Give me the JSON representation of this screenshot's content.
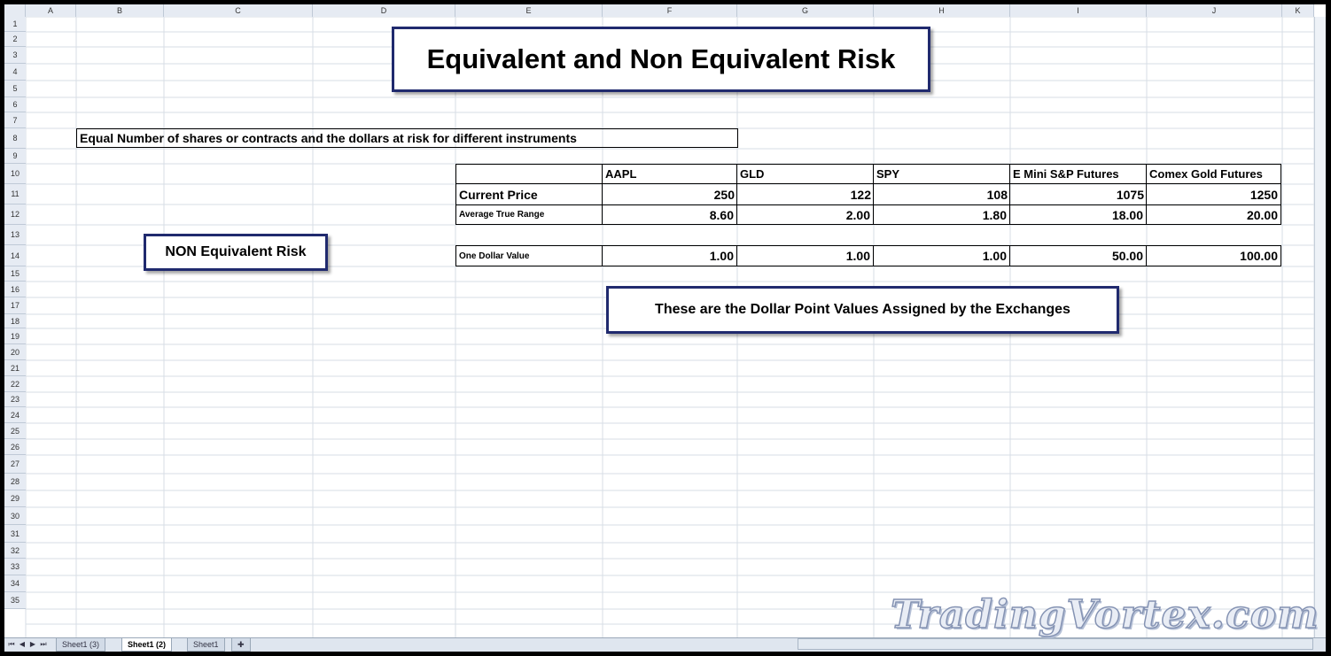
{
  "columns": [
    "A",
    "B",
    "C",
    "D",
    "E",
    "F",
    "G",
    "H",
    "I",
    "J",
    "K"
  ],
  "row_count": 35,
  "title": "Equivalent and Non Equivalent Risk",
  "subtitle": "Equal Number of shares or contracts and the dollars at risk for different instruments",
  "non_equivalent_label": "NON Equivalent Risk",
  "exchange_note": "These are the Dollar Point Values Assigned by the Exchanges",
  "table": {
    "instruments": [
      "AAPL",
      "GLD",
      "SPY",
      "E Mini S&P Futures",
      "Comex Gold Futures"
    ],
    "rows": [
      {
        "label": "Current Price",
        "values": [
          "250",
          "122",
          "108",
          "1075",
          "1250"
        ]
      },
      {
        "label": "Average True Range",
        "values": [
          "8.60",
          "2.00",
          "1.80",
          "18.00",
          "20.00"
        ]
      },
      {
        "label": "One Dollar Value",
        "values": [
          "1.00",
          "1.00",
          "1.00",
          "50.00",
          "100.00"
        ]
      }
    ]
  },
  "sheet_tabs": [
    "Sheet1 (3)",
    "Sheet1 (2)",
    "Sheet1"
  ],
  "active_tab": "Sheet1 (2)",
  "watermark": "TradingVortex.com"
}
